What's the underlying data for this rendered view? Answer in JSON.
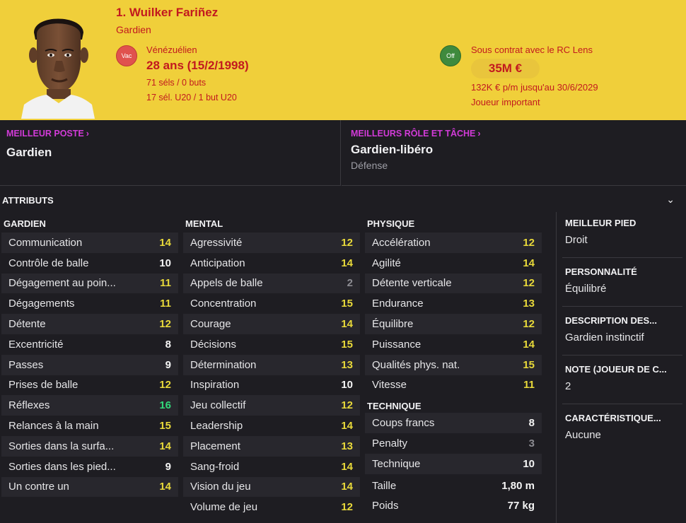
{
  "header": {
    "name": "1. Wuilker Fariñez",
    "position": "Gardien",
    "vac_badge": "Vac",
    "nationality": "Vénézuélien",
    "age": "28 ans (15/2/1998)",
    "caps": "71 séls / 0 buts",
    "caps_u20": "17 sél. U20 / 1 but U20",
    "off_badge": "Off",
    "contract": "Sous contrat avec le RC Lens",
    "value": "35M €",
    "wage": "132K € p/m jusqu'au 30/6/2029",
    "status": "Joueur important",
    "colors": {
      "background": "#f0cf3a",
      "text": "#c2191f"
    }
  },
  "best_position": {
    "title": "MEILLEUR POSTE",
    "value": "Gardien"
  },
  "best_role": {
    "title": "MEILLEURS RÔLE ET TÂCHE",
    "value": "Gardien-libéro",
    "sub": "Défense"
  },
  "attributes": {
    "title": "ATTRIBUTS",
    "gardien": {
      "title": "GARDIEN",
      "items": [
        {
          "label": "Communication",
          "value": "14"
        },
        {
          "label": "Contrôle de balle",
          "value": "10"
        },
        {
          "label": "Dégagement au poin...",
          "value": "11"
        },
        {
          "label": "Dégagements",
          "value": "11"
        },
        {
          "label": "Détente",
          "value": "12"
        },
        {
          "label": "Excentricité",
          "value": "8"
        },
        {
          "label": "Passes",
          "value": "9"
        },
        {
          "label": "Prises de balle",
          "value": "12"
        },
        {
          "label": "Réflexes",
          "value": "16"
        },
        {
          "label": "Relances à la main",
          "value": "15"
        },
        {
          "label": "Sorties dans la surfa...",
          "value": "14"
        },
        {
          "label": "Sorties dans les pied...",
          "value": "9"
        },
        {
          "label": "Un contre un",
          "value": "14"
        }
      ]
    },
    "mental": {
      "title": "MENTAL",
      "items": [
        {
          "label": "Agressivité",
          "value": "12"
        },
        {
          "label": "Anticipation",
          "value": "14"
        },
        {
          "label": "Appels de balle",
          "value": "2"
        },
        {
          "label": "Concentration",
          "value": "15"
        },
        {
          "label": "Courage",
          "value": "14"
        },
        {
          "label": "Décisions",
          "value": "15"
        },
        {
          "label": "Détermination",
          "value": "13"
        },
        {
          "label": "Inspiration",
          "value": "10"
        },
        {
          "label": "Jeu collectif",
          "value": "12"
        },
        {
          "label": "Leadership",
          "value": "14"
        },
        {
          "label": "Placement",
          "value": "13"
        },
        {
          "label": "Sang-froid",
          "value": "14"
        },
        {
          "label": "Vision du jeu",
          "value": "14"
        },
        {
          "label": "Volume de jeu",
          "value": "12"
        }
      ]
    },
    "physique": {
      "title": "PHYSIQUE",
      "items": [
        {
          "label": "Accélération",
          "value": "12"
        },
        {
          "label": "Agilité",
          "value": "14"
        },
        {
          "label": "Détente verticale",
          "value": "12"
        },
        {
          "label": "Endurance",
          "value": "13"
        },
        {
          "label": "Équilibre",
          "value": "12"
        },
        {
          "label": "Puissance",
          "value": "14"
        },
        {
          "label": "Qualités phys. nat.",
          "value": "15"
        },
        {
          "label": "Vitesse",
          "value": "11"
        }
      ]
    },
    "technique": {
      "title": "TECHNIQUE",
      "items": [
        {
          "label": "Coups francs",
          "value": "8"
        },
        {
          "label": "Penalty",
          "value": "3"
        },
        {
          "label": "Technique",
          "value": "10"
        }
      ]
    },
    "physical": {
      "height_label": "Taille",
      "height": "1,80 m",
      "weight_label": "Poids",
      "weight": "77 kg"
    }
  },
  "side": {
    "foot_title": "MEILLEUR PIED",
    "foot": "Droit",
    "personality_title": "PERSONNALITÉ",
    "personality": "Équilibré",
    "description_title": "DESCRIPTION DES...",
    "description": "Gardien instinctif",
    "note_title": "NOTE (JOUEUR DE C...",
    "note": "2",
    "trait_title": "CARACTÉRISTIQUE...",
    "trait": "Aucune"
  }
}
